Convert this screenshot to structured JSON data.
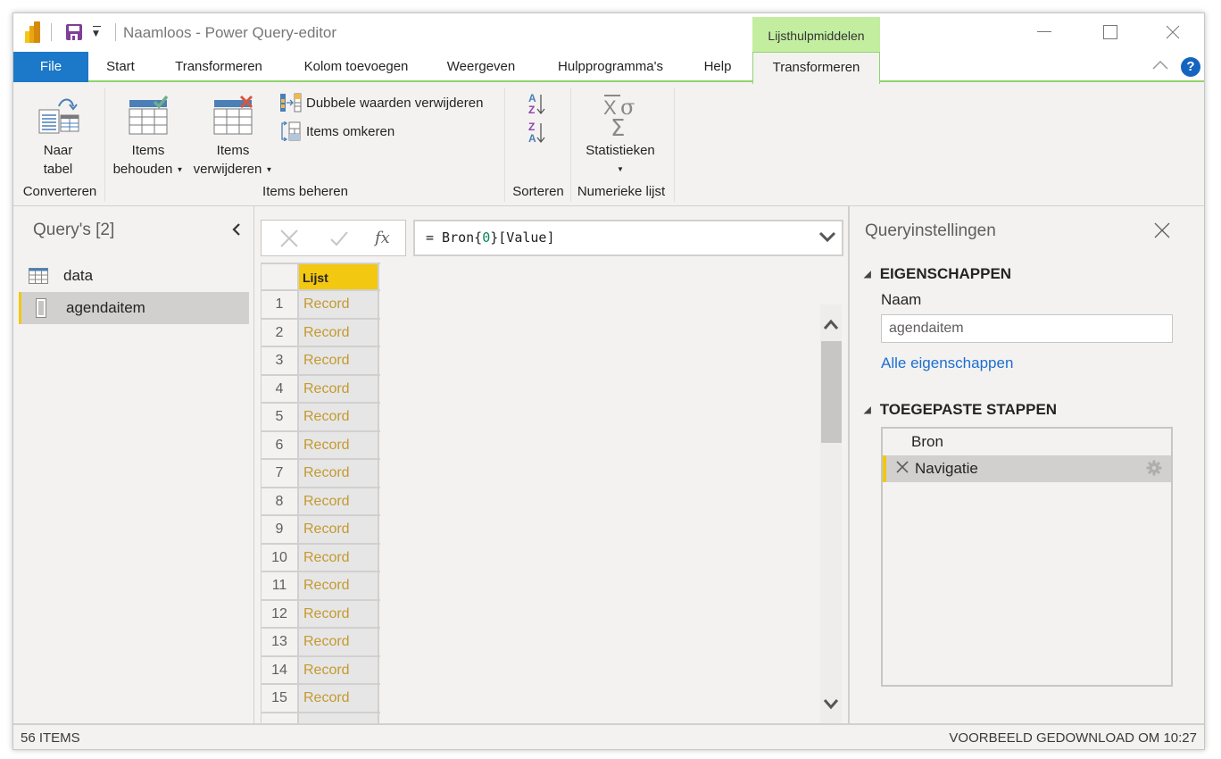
{
  "titlebar": {
    "title": "Naamloos - Power Query-editor",
    "context_tab_group": "Lijsthulpmiddelen",
    "icons": [
      "power-bi-logo",
      "save-icon",
      "qat-dropdown-icon",
      "minimize-icon",
      "maximize-icon",
      "close-icon"
    ]
  },
  "tabs": [
    {
      "label": "File"
    },
    {
      "label": "Start"
    },
    {
      "label": "Transformeren"
    },
    {
      "label": "Kolom toevoegen"
    },
    {
      "label": "Weergeven"
    },
    {
      "label": "Hulpprogramma's"
    },
    {
      "label": "Help"
    },
    {
      "label": "Transformeren",
      "active": true,
      "context": true
    }
  ],
  "help_label": "?",
  "ribbon": {
    "groups": {
      "converteren": {
        "label": "Converteren",
        "naar_tabel_line1": "Naar",
        "naar_tabel_line2": "tabel"
      },
      "items_beheren": {
        "label": "Items beheren",
        "behouden_line1": "Items",
        "behouden_line2": "behouden",
        "verwijderen_line1": "Items",
        "verwijderen_line2": "verwijderen",
        "dubbele": "Dubbele waarden verwijderen",
        "omkeren": "Items omkeren"
      },
      "sorteren": {
        "label": "Sorteren",
        "asc": "A→Z",
        "desc": "Z→A"
      },
      "numerieke_lijst": {
        "label": "Numerieke lijst",
        "statistieken": "Statistieken"
      }
    }
  },
  "queries": {
    "title": "Query's [2]",
    "items": [
      {
        "label": "data",
        "icon": "table-icon",
        "selected": false
      },
      {
        "label": "agendaitem",
        "icon": "list-icon",
        "selected": true
      }
    ]
  },
  "formula_bar": {
    "prefix": "= Bron{",
    "number": "0",
    "suffix": "}[Value]"
  },
  "grid": {
    "column_header": "Lijst",
    "rows": [
      {
        "index": "1",
        "value": "Record"
      },
      {
        "index": "2",
        "value": "Record"
      },
      {
        "index": "3",
        "value": "Record"
      },
      {
        "index": "4",
        "value": "Record"
      },
      {
        "index": "5",
        "value": "Record"
      },
      {
        "index": "6",
        "value": "Record"
      },
      {
        "index": "7",
        "value": "Record"
      },
      {
        "index": "8",
        "value": "Record"
      },
      {
        "index": "9",
        "value": "Record"
      },
      {
        "index": "10",
        "value": "Record"
      },
      {
        "index": "11",
        "value": "Record"
      },
      {
        "index": "12",
        "value": "Record"
      },
      {
        "index": "13",
        "value": "Record"
      },
      {
        "index": "14",
        "value": "Record"
      },
      {
        "index": "15",
        "value": "Record"
      },
      {
        "index": "",
        "value": ""
      }
    ]
  },
  "settings": {
    "title": "Queryinstellingen",
    "properties_header": "EIGENSCHAPPEN",
    "name_label": "Naam",
    "name_value": "agendaitem",
    "all_properties_link": "Alle eigenschappen",
    "steps_header": "TOEGEPASTE STAPPEN",
    "steps": [
      {
        "label": "Bron",
        "selected": false
      },
      {
        "label": "Navigatie",
        "selected": true
      }
    ]
  },
  "statusbar": {
    "left": "56 ITEMS",
    "right": "VOORBEELD GEDOWNLOAD OM 10:27"
  },
  "colors": {
    "file_tab": "#1c78c8",
    "context_tab": "#c3eea0",
    "accent_yellow": "#f2c811",
    "record_text": "#c49a2f",
    "link": "#1e6fcf"
  }
}
